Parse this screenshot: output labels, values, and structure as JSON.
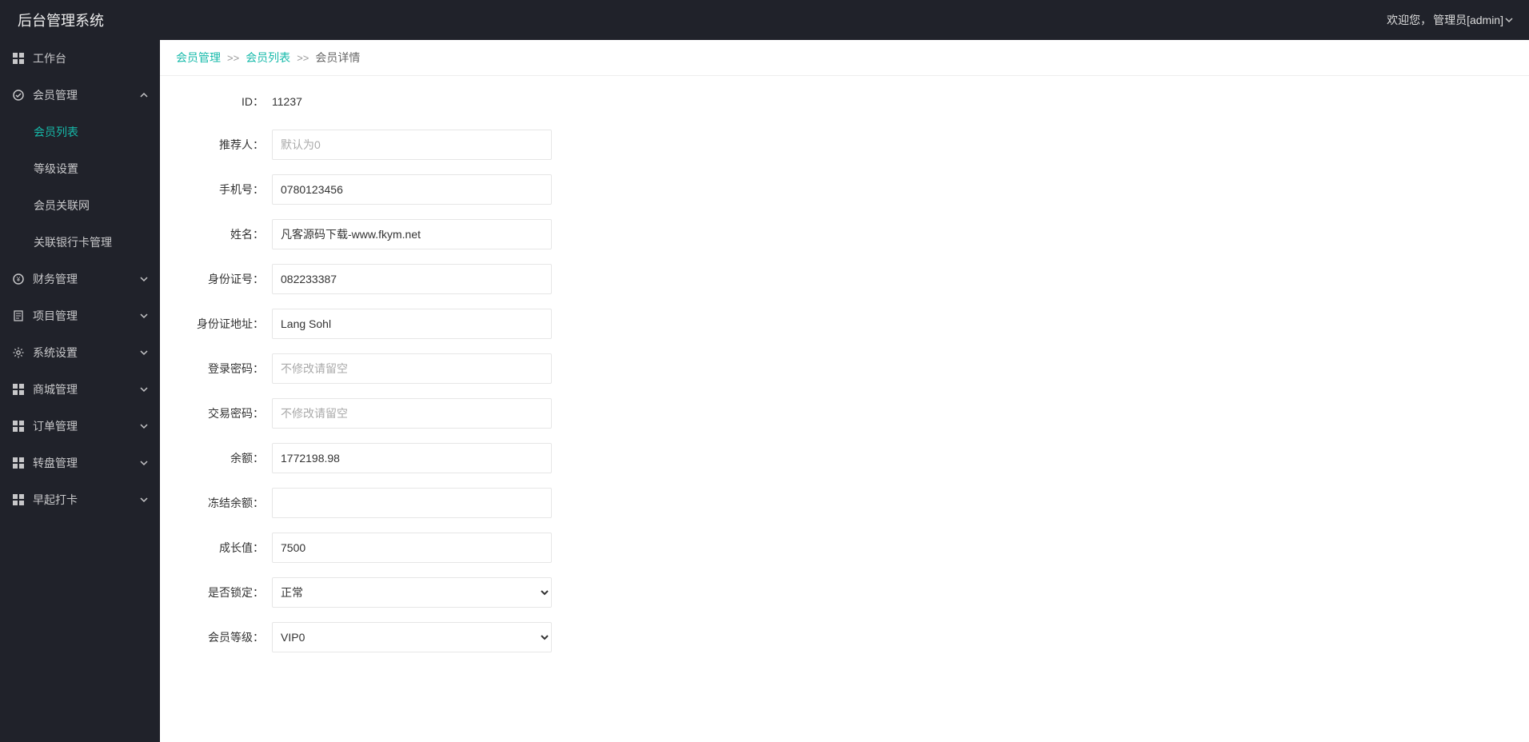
{
  "app": {
    "title": "后台管理系统"
  },
  "header": {
    "welcome_prefix": "欢迎您，",
    "user_label": "管理员[admin]"
  },
  "sidebar": {
    "items": [
      {
        "icon": "grid-icon",
        "label": "工作台",
        "expandable": false
      },
      {
        "icon": "circle-icon",
        "label": "会员管理",
        "expandable": true,
        "expanded": true,
        "children": [
          {
            "label": "会员列表",
            "active": true
          },
          {
            "label": "等级设置"
          },
          {
            "label": "会员关联网"
          },
          {
            "label": "关联银行卡管理"
          }
        ]
      },
      {
        "icon": "circle-icon",
        "label": "财务管理",
        "expandable": true
      },
      {
        "icon": "doc-icon",
        "label": "项目管理",
        "expandable": true
      },
      {
        "icon": "gear-icon",
        "label": "系统设置",
        "expandable": true
      },
      {
        "icon": "grid-icon",
        "label": "商城管理",
        "expandable": true
      },
      {
        "icon": "grid-icon",
        "label": "订单管理",
        "expandable": true
      },
      {
        "icon": "grid-icon",
        "label": "转盘管理",
        "expandable": true
      },
      {
        "icon": "grid-icon",
        "label": "早起打卡",
        "expandable": true
      }
    ]
  },
  "breadcrumb": {
    "items": [
      {
        "label": "会员管理",
        "link": true
      },
      {
        "label": "会员列表",
        "link": true
      },
      {
        "label": "会员详情",
        "link": false
      }
    ],
    "separator": ">>"
  },
  "form": {
    "id_label": "ID：",
    "id_value": "11237",
    "referrer_label": "推荐人：",
    "referrer_value": "",
    "referrer_placeholder": "默认为0",
    "phone_label": "手机号：",
    "phone_value": "0780123456",
    "name_label": "姓名：",
    "name_value": "凡客源码下载-www.fkym.net",
    "idcard_label": "身份证号：",
    "idcard_value": "082233387",
    "idaddr_label": "身份证地址：",
    "idaddr_value": "Lang Sohl",
    "loginpwd_label": "登录密码：",
    "loginpwd_value": "",
    "loginpwd_placeholder": "不修改请留空",
    "txnpwd_label": "交易密码：",
    "txnpwd_value": "",
    "txnpwd_placeholder": "不修改请留空",
    "balance_label": "余额：",
    "balance_value": "1772198.98",
    "frozen_label": "冻结余额：",
    "frozen_value": "",
    "growth_label": "成长值：",
    "growth_value": "7500",
    "lock_label": "是否锁定：",
    "lock_selected": "正常",
    "level_label": "会员等级：",
    "level_selected": "VIP0"
  }
}
